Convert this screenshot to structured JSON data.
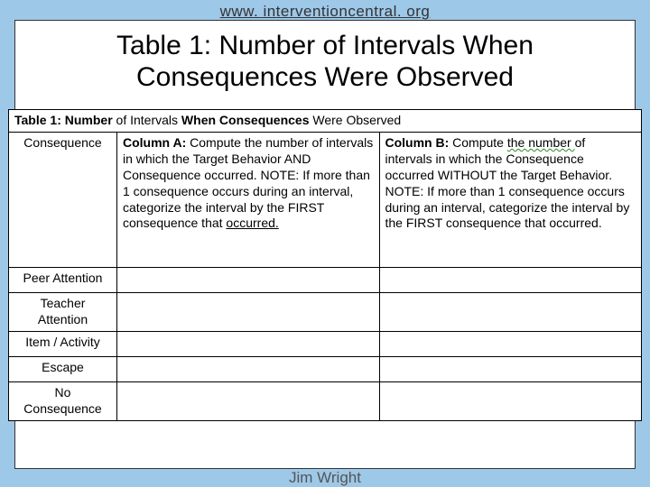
{
  "header_url": "www. interventioncentral. org",
  "slide_title": "Table 1: Number of Intervals When Consequences Were Observed",
  "table_caption_prefix_bold": "Table 1: Number ",
  "table_caption_mid1": "of Intervals ",
  "table_caption_mid_bold": "When Consequences ",
  "table_caption_end": "Were Observed",
  "row_consequence": "Consequence",
  "colA_label_bold": "Column A:",
  "colA_text_1": " Compute ",
  "colA_text_2": "the number of",
  "colA_text_3": " intervals in which the Target Behavior AND Consequence occurred.  NOTE: If more than 1 consequence occurs ",
  "colA_text_4": "during an",
  "colA_text_5": " interval, categorize ",
  "colA_text_6": "the interval by",
  "colA_text_7": " the FIRST consequence that ",
  "colA_text_8": "occurred.",
  "colB_label_bold": "Column B:",
  "colB_text_1": " Compute ",
  "colB_text_2": "the  number ",
  "colB_text_3": "of intervals in which the Consequence occurred WITHOUT the Target Behavior. NOTE: If more than 1 consequence occurs ",
  "colB_text_4": "during an interval,",
  "colB_text_5": " categorize ",
  "colB_text_6": "the interval by the FIRST",
  "colB_text_7": " consequence that occurred.",
  "row_peer": "Peer Attention",
  "row_teacher": "Teacher Attention",
  "row_item": "Item / Activity",
  "row_escape": "Escape",
  "row_none": "No Consequence",
  "footer": "Jim Wright"
}
